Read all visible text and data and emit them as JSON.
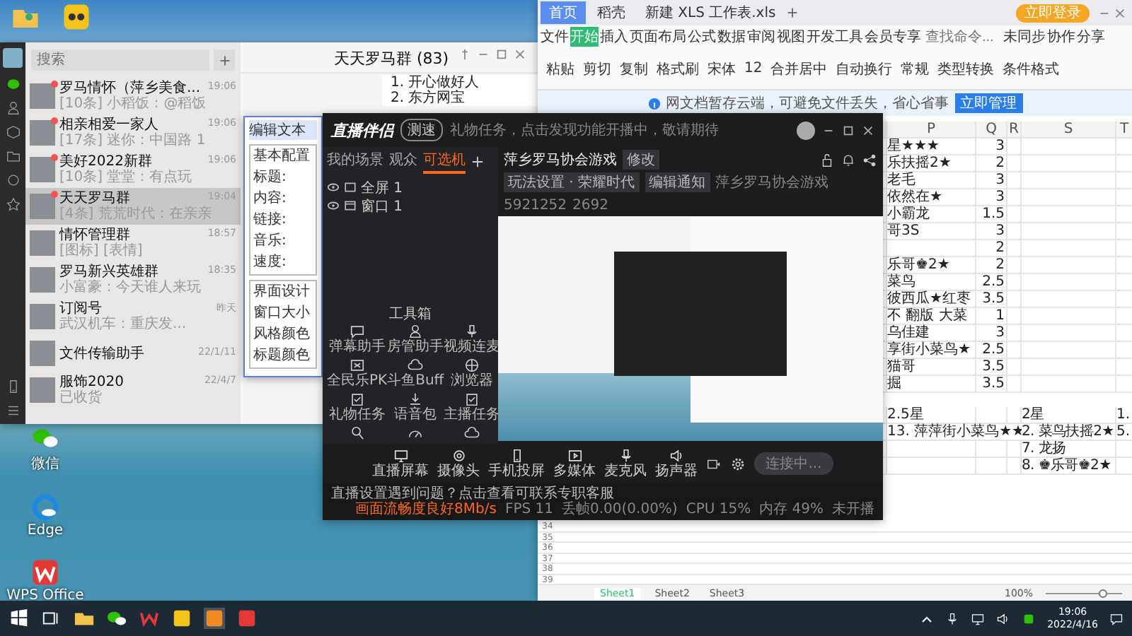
{
  "desktop_icons": [
    {
      "label": "微信",
      "kind": "wechat"
    },
    {
      "label": "Edge",
      "kind": "browser"
    },
    {
      "label": "WPS Office",
      "kind": "wps"
    }
  ],
  "wechat": {
    "search": {
      "placeholder": "搜索"
    },
    "chats": [
      {
        "name": "罗马情怀（萍乡美食...",
        "preview": "[10条] 小稻饭：@稻饭",
        "time": "19:06",
        "unread": true,
        "selected": false
      },
      {
        "name": "相亲相爱一家人",
        "preview": "[17条] 迷你：中国路 1",
        "time": "19:06",
        "unread": true,
        "selected": false
      },
      {
        "name": "美好2022新群",
        "preview": "[10条] 堂堂：有点玩",
        "time": "19:06",
        "unread": true,
        "selected": false
      },
      {
        "name": "天天罗马群",
        "preview": "[4条] 荒荒时代：在亲亲",
        "time": "19:04",
        "unread": true,
        "selected": true
      },
      {
        "name": "情怀管理群",
        "preview": "[图标] [表情]",
        "time": "18:57",
        "unread": false,
        "selected": false
      },
      {
        "name": "罗马新兴英雄群",
        "preview": "小富豪：今天谁人来玩",
        "time": "18:35",
        "unread": false,
        "selected": false
      },
      {
        "name": "订阅号",
        "preview": "武汉机车：重庆发...",
        "time": "昨天",
        "unread": false,
        "selected": false
      },
      {
        "name": "文件传输助手",
        "time": "22/1/11",
        "unread": false,
        "selected": false
      },
      {
        "name": "服饰2020",
        "preview": "已收货",
        "time": "22/4/7",
        "unread": false,
        "selected": false
      }
    ],
    "chat_title": "天天罗马群 (83)",
    "messages": [
      "1. 开心做好人",
      "2. 东方网宝"
    ]
  },
  "dialog": {
    "title": "编辑文本",
    "groups": [
      {
        "title": "基本配置",
        "fields": [
          "标题:",
          "内容:",
          "链接:",
          "音乐:",
          "速度:"
        ]
      },
      {
        "title": "界面设计",
        "fields": [
          "窗口大小",
          "风格颜色",
          "标题颜色"
        ]
      }
    ]
  },
  "stream": {
    "app_name": "直播伴侣",
    "badge": "测速",
    "notice": "礼物任务，点击发现功能开播中，敬请期待",
    "tabs": [
      {
        "label": "我的场景",
        "selected": false
      },
      {
        "label": "观众",
        "selected": false
      },
      {
        "label": "可选机",
        "selected": true
      }
    ],
    "sources": [
      {
        "label": "全屏 1",
        "kind": "screen"
      },
      {
        "label": "窗口 1",
        "kind": "window"
      }
    ],
    "room_title": "萍乡罗马协会游戏",
    "edit_label": "修改",
    "chips": [
      "玩法设置 · 荣耀时代",
      "编辑通知"
    ],
    "room_name": "萍乡罗马协会游戏",
    "room_id": "5921252",
    "popularity": "2692",
    "toolbox_title": "工具箱",
    "tools": [
      {
        "label": "弹幕助手",
        "kind": "chat"
      },
      {
        "label": "房管助手",
        "kind": "person"
      },
      {
        "label": "视频连麦",
        "kind": "mic"
      },
      {
        "label": "全民乐PK",
        "kind": "pk"
      },
      {
        "label": "斗鱼Buff",
        "kind": "cloud"
      },
      {
        "label": "浏览器",
        "kind": "globe"
      },
      {
        "label": "礼物任务",
        "kind": "task"
      },
      {
        "label": "语音包",
        "kind": "download"
      },
      {
        "label": "主播任务",
        "kind": "task"
      },
      {
        "kind": "search"
      },
      {
        "kind": "gauge"
      },
      {
        "kind": "cloud"
      }
    ],
    "controls": [
      {
        "label": "直播屏幕",
        "kind": "screen"
      },
      {
        "label": "摄像头",
        "kind": "camera"
      },
      {
        "label": "手机投屏",
        "kind": "phone"
      },
      {
        "label": "多媒体",
        "kind": "media"
      },
      {
        "label": "麦克风",
        "kind": "mic"
      },
      {
        "label": "扬声器",
        "kind": "speaker"
      }
    ],
    "connect_button": "连接中...",
    "help_text": "直播设置遇到问题？点击查看可联系专职客服",
    "stats": [
      "画面流畅度良好8Mb/s",
      "FPS 11",
      "丢帧0.00(0.00%)",
      "CPU 15%",
      "内存 49%",
      "未开播"
    ]
  },
  "excel": {
    "tabs": [
      {
        "label": "首页",
        "selected": true
      },
      {
        "label": "稻壳",
        "selected": false
      },
      {
        "label": "新建 XLS 工作表.xls",
        "selected": false
      }
    ],
    "login_button": "立即登录",
    "menu": [
      {
        "label": "文件",
        "selected": false
      },
      {
        "label": "开始",
        "selected": true
      },
      {
        "label": "插入",
        "selected": false
      },
      {
        "label": "页面布局",
        "selected": false
      },
      {
        "label": "公式",
        "selected": false
      },
      {
        "label": "数据",
        "selected": false
      },
      {
        "label": "审阅",
        "selected": false
      },
      {
        "label": "视图",
        "selected": false
      },
      {
        "label": "开发工具",
        "selected": false
      },
      {
        "label": "会员专享",
        "selected": false
      }
    ],
    "search_placeholder": "查找命令...",
    "menu_right": [
      "未同步",
      "协作",
      "分享"
    ],
    "ribbon": [
      "粘贴",
      "剪切",
      "复制",
      "格式刷",
      "宋体",
      "12",
      "合并居中",
      "自动换行",
      "常规",
      "类型转换",
      "条件格式"
    ],
    "banner": "网文档暂存云端，可避免文件丢失，省心省事",
    "banner_button": "立即管理",
    "columns": [
      "P",
      "Q",
      "R",
      "S",
      "T"
    ],
    "upper_rows": [
      {
        "P": "星★★★",
        "Q": "3"
      },
      {
        "P": "乐扶摇2★",
        "Q": "2"
      },
      {
        "P": "老毛",
        "Q": "3"
      },
      {
        "P": "依然在★",
        "Q": "3"
      },
      {
        "P": "小霸龙",
        "Q": "1.5"
      },
      {
        "P": "哥3S",
        "Q": "3"
      },
      {
        "Q": "2"
      },
      {
        "P": "乐哥♚2★",
        "Q": "2"
      },
      {
        "P": "菜鸟",
        "Q": "2.5"
      },
      {
        "P": "彼西瓜★红枣",
        "Q": "3.5"
      },
      {
        "P": "不 翻版 大菜",
        "Q": "1"
      },
      {
        "P": "乌佳建",
        "Q": "3"
      },
      {
        "P": "享街小菜鸟★",
        "Q": "2.5"
      },
      {
        "P": "猫哥",
        "Q": "3.5"
      },
      {
        "P": "掘",
        "Q": "3.5"
      }
    ],
    "lower_rows": [
      {
        "P": "2.5星",
        "S": "2星",
        "T": "1."
      },
      {
        "P": "13. 萍萍街小菜鸟★★",
        "S": "2. 菜鸟扶摇2★",
        "T": "5."
      },
      {
        "S": "7. 龙扬"
      },
      {
        "S": "8. ♚乐哥♚2★"
      }
    ],
    "row_numbers": [
      "34",
      "35",
      "36",
      "37",
      "38",
      "39"
    ],
    "sheets": [
      {
        "label": "Sheet1",
        "selected": true
      },
      {
        "label": "Sheet2",
        "selected": false
      },
      {
        "label": "Sheet3",
        "selected": false
      }
    ],
    "zoom": "100%",
    "zoom_slider": {
      "level": 0.75
    }
  },
  "taskbar": {
    "time": "19:06",
    "date": "2022/4/16"
  }
}
